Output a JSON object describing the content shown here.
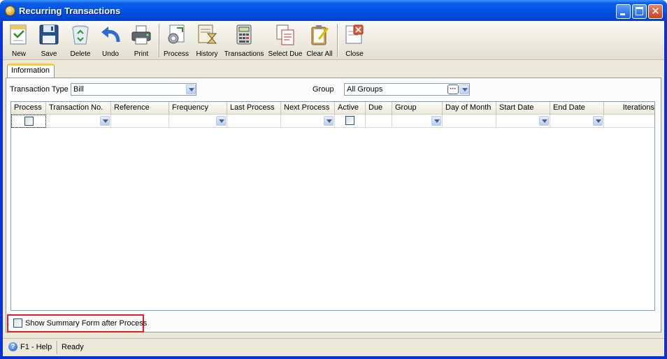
{
  "window": {
    "title": "Recurring Transactions"
  },
  "toolbar": {
    "buttons": [
      {
        "label": "New",
        "icon": "new-document-icon"
      },
      {
        "label": "Save",
        "icon": "floppy-disk-icon"
      },
      {
        "label": "Delete",
        "icon": "recycle-bin-icon"
      },
      {
        "label": "Undo",
        "icon": "undo-arrow-icon"
      },
      {
        "label": "Print",
        "icon": "printer-icon"
      },
      {
        "label": "Process",
        "icon": "process-gears-icon"
      },
      {
        "label": "History",
        "icon": "history-hourglass-icon"
      },
      {
        "label": "Transactions",
        "icon": "transactions-calculator-icon"
      },
      {
        "label": "Select Due",
        "icon": "select-due-documents-icon"
      },
      {
        "label": "Clear All",
        "icon": "clear-all-clipboard-icon"
      },
      {
        "label": "Close",
        "icon": "close-form-icon"
      }
    ]
  },
  "tabs": [
    {
      "label": "Information"
    }
  ],
  "filters": {
    "transaction_type_label": "Transaction Type",
    "transaction_type_value": "Bill",
    "group_label": "Group",
    "group_value": "All Groups"
  },
  "grid": {
    "columns": [
      "Process",
      "Transaction No.",
      "Reference",
      "Frequency",
      "Last Process",
      "Next Process",
      "Active",
      "Due",
      "Group",
      "Day of Month",
      "Start Date",
      "End Date",
      "Iterations"
    ]
  },
  "options": {
    "show_summary_label": "Show Summary Form after Process"
  },
  "status": {
    "help": "F1 - Help",
    "text": "Ready"
  },
  "colors": {
    "titlebar": "#0054e3",
    "highlight_border": "#e02020",
    "tab_accent": "#ffc83c"
  }
}
